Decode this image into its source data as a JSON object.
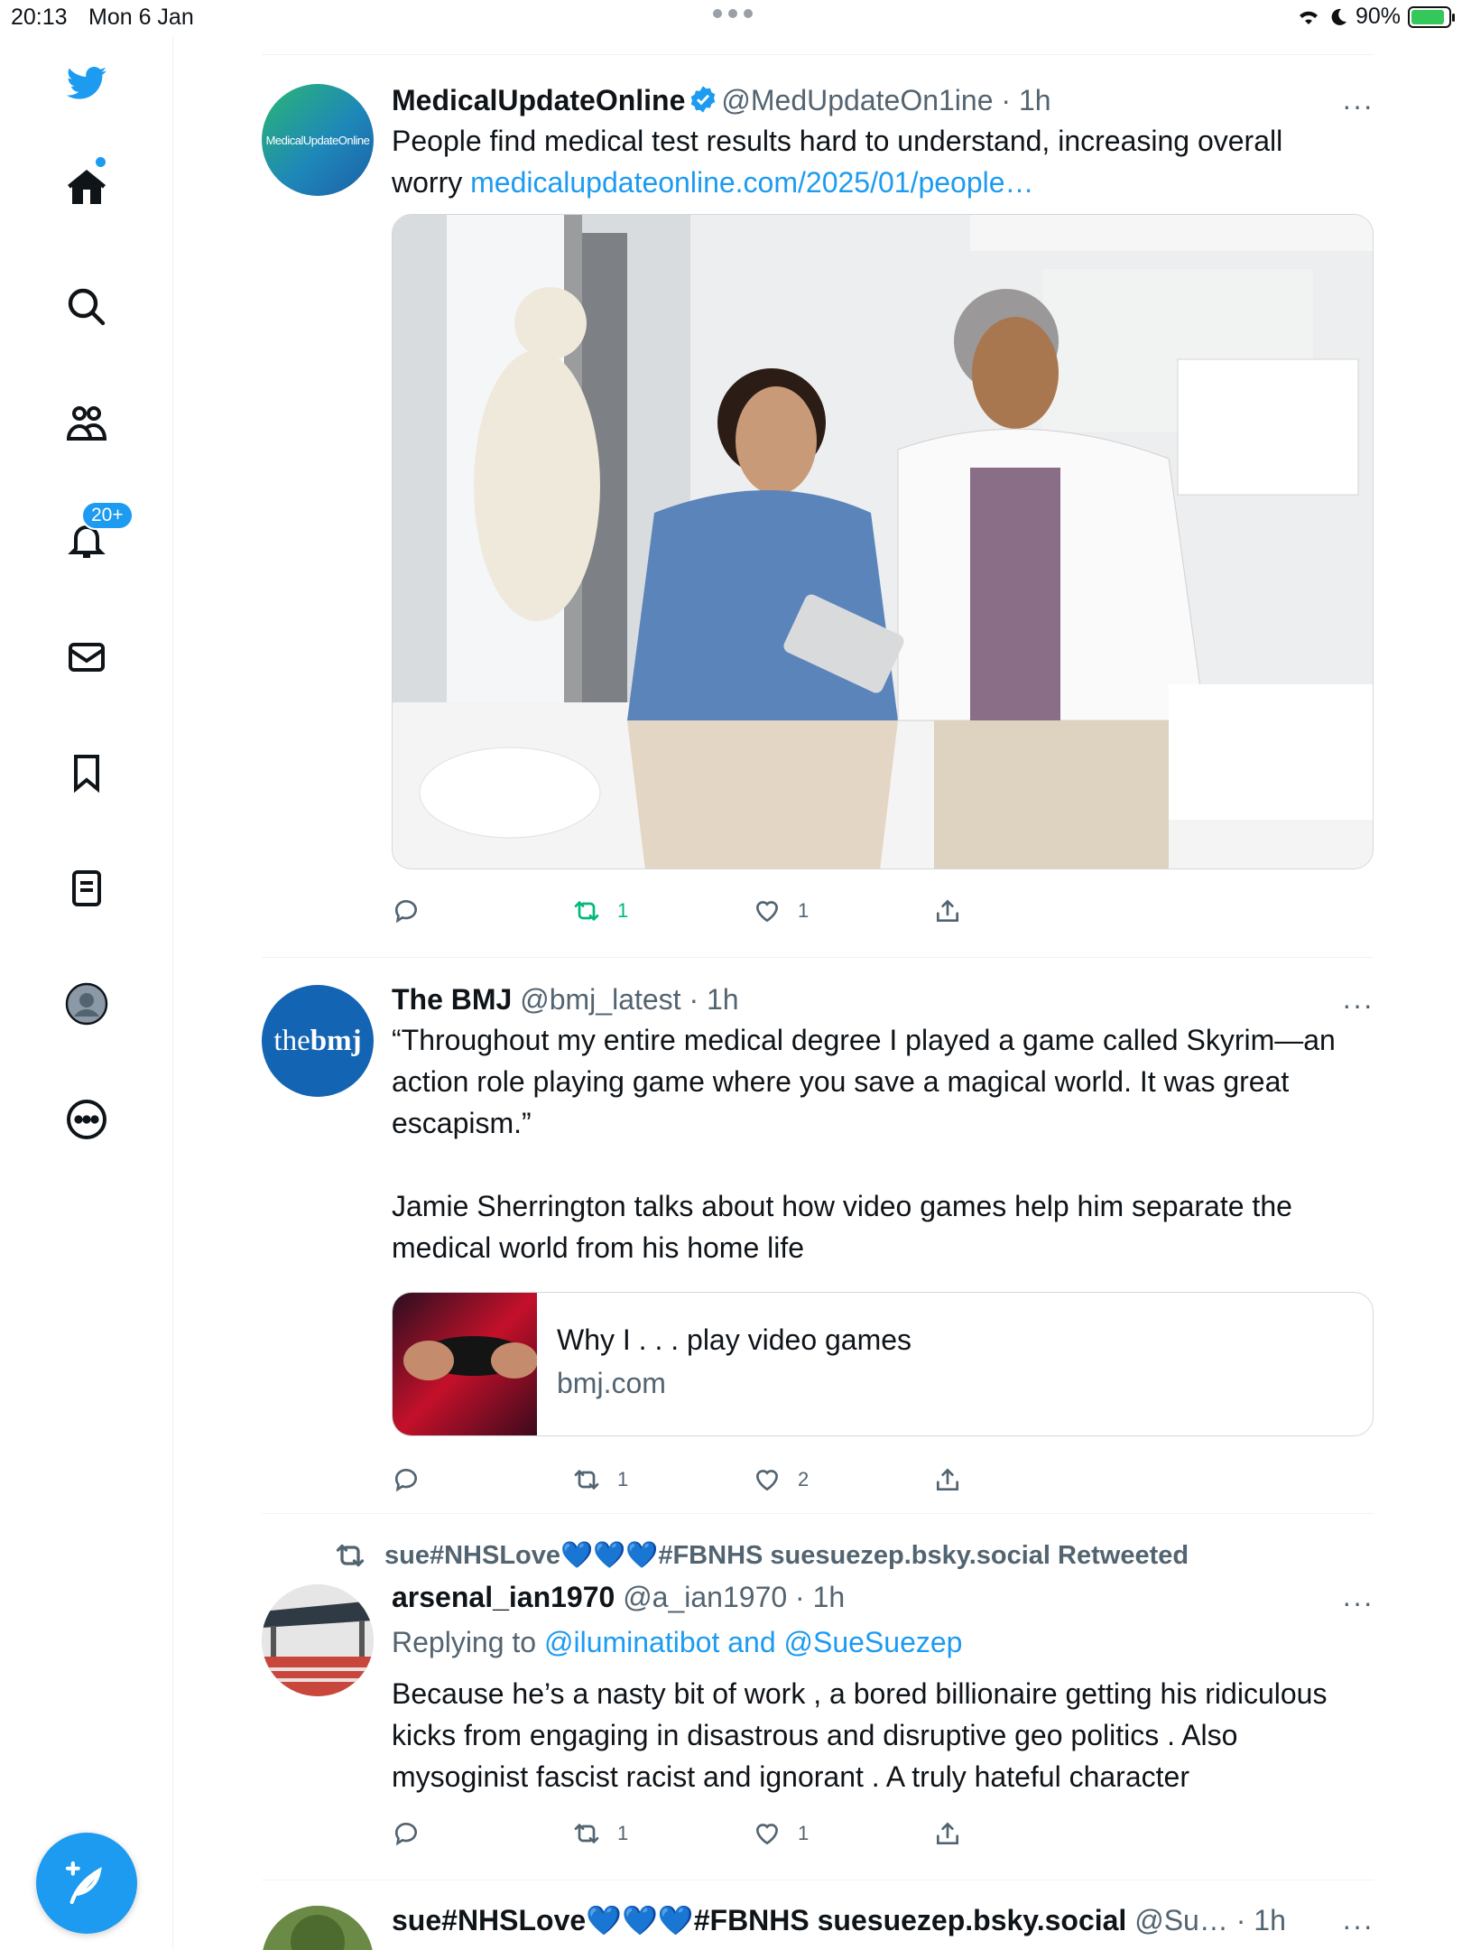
{
  "status_bar": {
    "time": "20:13",
    "date": "Mon 6 Jan",
    "battery": "90%"
  },
  "sidebar": {
    "notifications_badge": "20+",
    "items": [
      {
        "icon": "twitter-bird-icon"
      },
      {
        "icon": "home-icon"
      },
      {
        "icon": "search-icon"
      },
      {
        "icon": "communities-icon"
      },
      {
        "icon": "bell-icon"
      },
      {
        "icon": "mail-icon"
      },
      {
        "icon": "bookmark-icon"
      },
      {
        "icon": "lists-icon"
      },
      {
        "icon": "profile-icon"
      },
      {
        "icon": "more-icon"
      }
    ]
  },
  "colors": {
    "accent": "#1d9bf0",
    "retweet_active": "#00ba7c",
    "secondary_text": "#536471"
  },
  "tweets": [
    {
      "name": "MedicalUpdateOnline",
      "handle": "@MedUpdateOn1ine",
      "time": "· 1h",
      "text": "People find medical test results hard to understand, increasing overall worry ",
      "link": "medicalupdateonline.com/2025/01/people…",
      "avatar_text": "MedicalUpdateOnline",
      "replies": "",
      "retweets": "1",
      "likes": "1"
    },
    {
      "name": "The BMJ",
      "handle": "@bmj_latest",
      "time": "· 1h",
      "text_p1": "“Throughout my entire medical degree I played a game called Skyrim—an action role playing game where you save a magical world. It was great escapism.”",
      "text_p2": "Jamie Sherrington talks about how video games help him separate the medical world from his home life",
      "avatar_text_a": "the",
      "avatar_text_b": "bmj",
      "card_title": "Why I . . . play video games",
      "card_domain": "bmj.com",
      "replies": "",
      "retweets": "1",
      "likes": "2"
    },
    {
      "retweeted_by": "sue#NHSLove💙💙💙#FBNHS suesuezep.bsky.social Retweeted",
      "name": "arsenal_ian1970",
      "handle": "@a_ian1970",
      "time": "· 1h",
      "replying_prefix": "Replying to ",
      "replying_to": "@iluminatibot and @SueSuezep",
      "text": "Because he’s a nasty bit of  work , a bored billionaire getting his ridiculous kicks from engaging in disastrous and disruptive geo politics . Also mysoginist fascist racist and ignorant . A truly hateful character",
      "replies": "",
      "retweets": "1",
      "likes": "1"
    },
    {
      "name": "sue#NHSLove💙💙💙#FBNHS suesuezep.bsky.social",
      "handle": "@Su…",
      "time": "· 1h"
    }
  ],
  "more_glyph": "···"
}
